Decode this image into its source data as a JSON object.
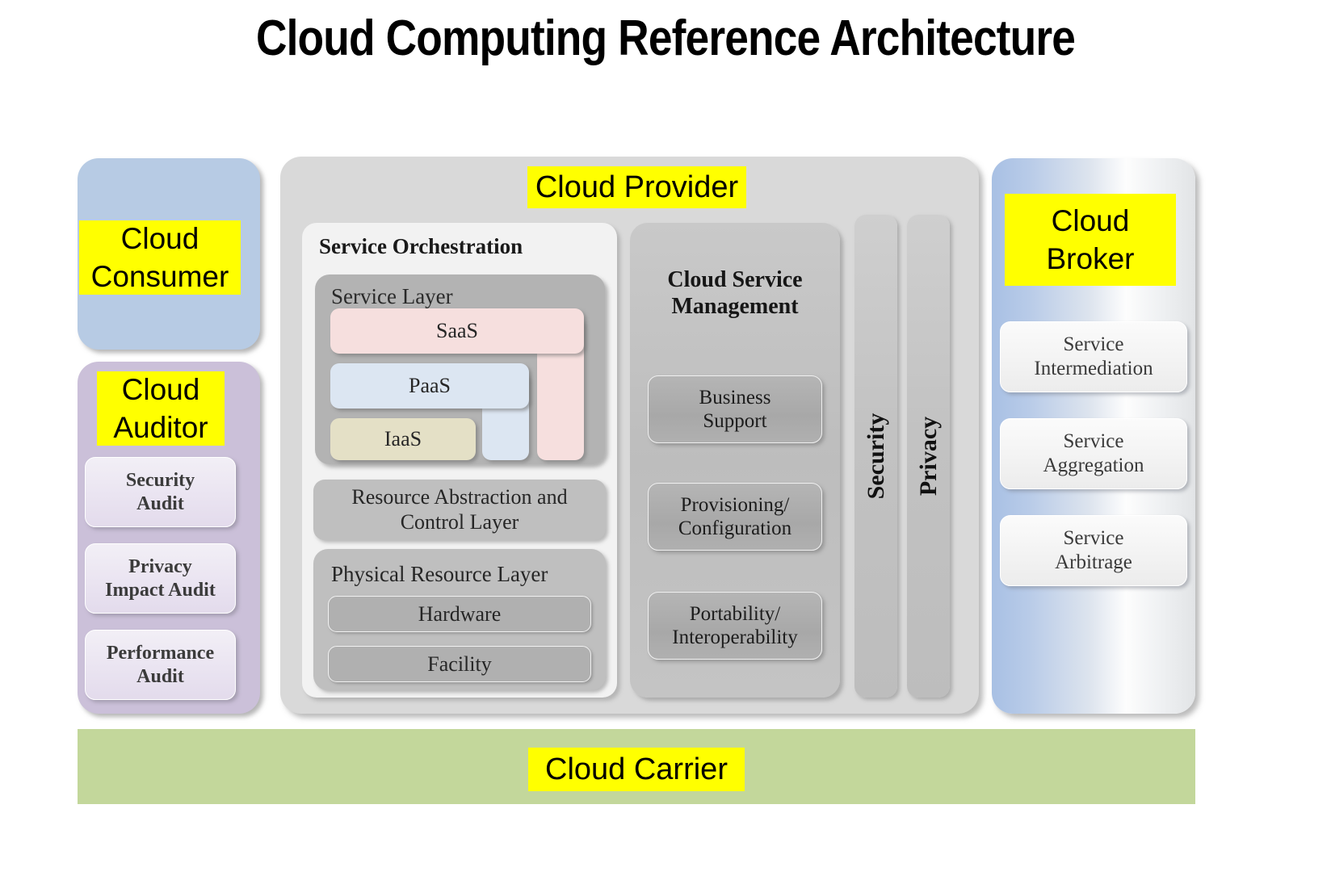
{
  "title": "Cloud Computing Reference Architecture",
  "colors": {
    "highlight": "#ffff00",
    "consumer": "#b7cbe4",
    "auditor": "#cbc0d9",
    "provider": "#d9d9d9",
    "broker_gradient_start": "#a8c0e4",
    "broker_gradient_end": "#e2e4e6",
    "carrier": "#c3d79b",
    "saas": "#f6dfde",
    "paas": "#dce6f2",
    "iaas": "#e4e0c6",
    "service_layer": "#b3b3b3",
    "management": "#bdbdbd"
  },
  "consumer": {
    "label": "Cloud\nConsumer"
  },
  "auditor": {
    "label": "Cloud\nAuditor",
    "items": [
      {
        "label": "Security\nAudit"
      },
      {
        "label": "Privacy\nImpact Audit"
      },
      {
        "label": "Performance\nAudit"
      }
    ]
  },
  "provider": {
    "label": "Cloud Provider",
    "orchestration": {
      "title": "Service Orchestration",
      "service_layer": {
        "title": "Service Layer",
        "layers": [
          {
            "label": "SaaS"
          },
          {
            "label": "PaaS"
          },
          {
            "label": "IaaS"
          }
        ]
      },
      "resource_abstraction": "Resource Abstraction and\nControl Layer",
      "physical_layer": {
        "title": "Physical Resource Layer",
        "items": [
          {
            "label": "Hardware"
          },
          {
            "label": "Facility"
          }
        ]
      }
    },
    "management": {
      "title": "Cloud Service\nManagement",
      "items": [
        {
          "label": "Business\nSupport"
        },
        {
          "label": "Provisioning/\nConfiguration"
        },
        {
          "label": "Portability/\nInteroperability"
        }
      ]
    },
    "cross_cutting": [
      {
        "label": "Security"
      },
      {
        "label": "Privacy"
      }
    ]
  },
  "broker": {
    "label": "Cloud\nBroker",
    "items": [
      {
        "label": "Service\nIntermediation"
      },
      {
        "label": "Service\nAggregation"
      },
      {
        "label": "Service\nArbitrage"
      }
    ]
  },
  "carrier": {
    "label": "Cloud Carrier"
  }
}
